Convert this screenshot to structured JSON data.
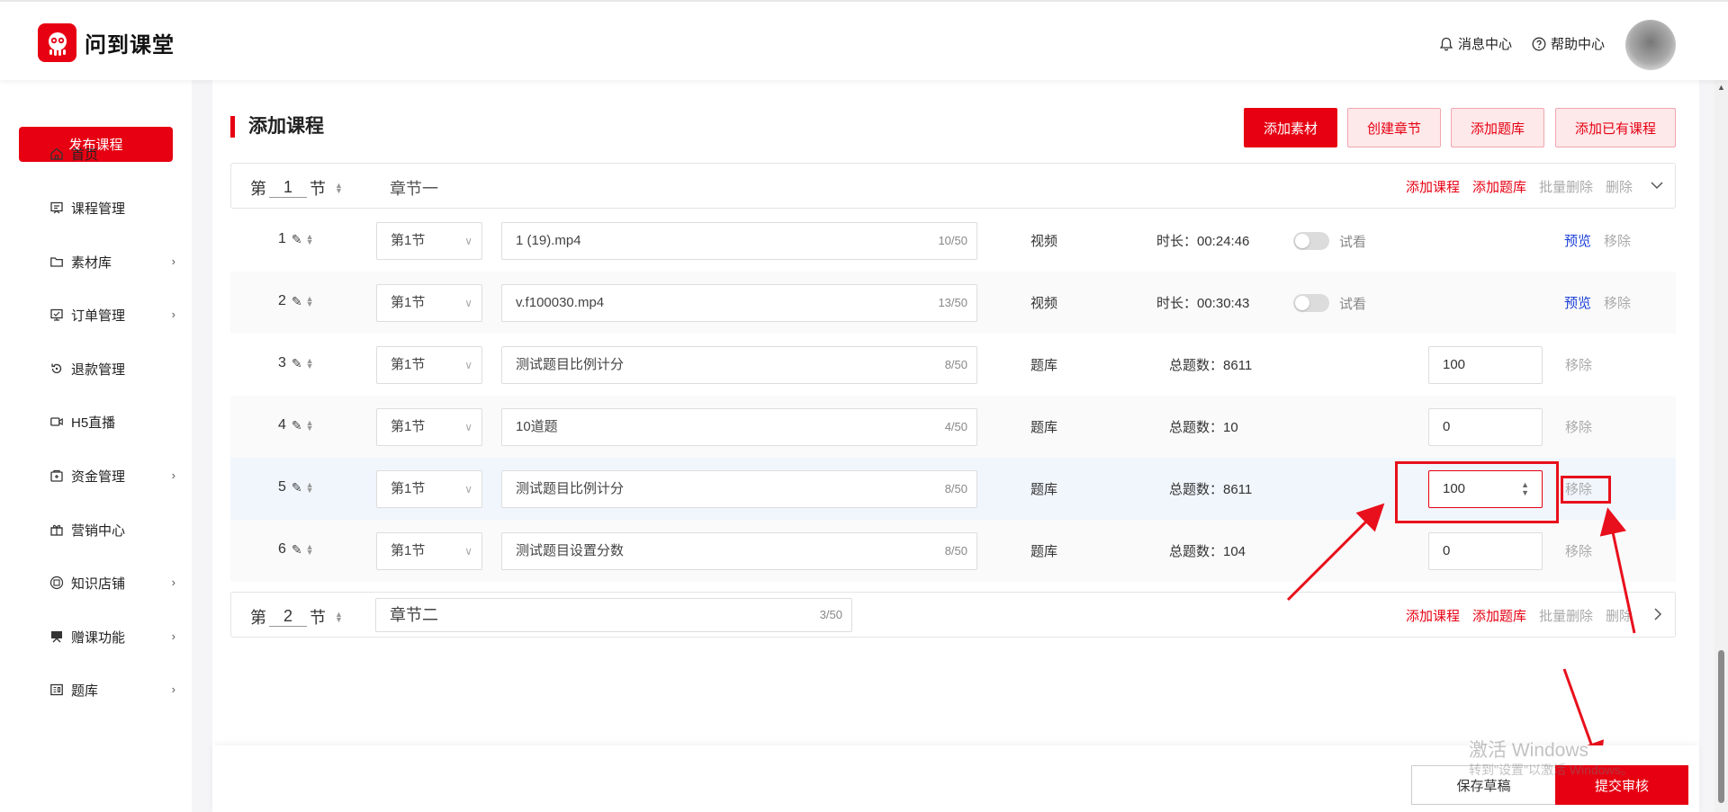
{
  "app": {
    "name": "问到课堂"
  },
  "header": {
    "messages": "消息中心",
    "help": "帮助中心"
  },
  "sidebar": {
    "publish": "发布课程",
    "items": [
      {
        "label": "首页",
        "icon": "home-icon",
        "chevron": false
      },
      {
        "label": "课程管理",
        "icon": "course-icon",
        "chevron": false
      },
      {
        "label": "素材库",
        "icon": "folder-icon",
        "chevron": true
      },
      {
        "label": "订单管理",
        "icon": "order-icon",
        "chevron": true
      },
      {
        "label": "退款管理",
        "icon": "refund-icon",
        "chevron": false
      },
      {
        "label": "H5直播",
        "icon": "live-icon",
        "chevron": false
      },
      {
        "label": "资金管理",
        "icon": "wallet-icon",
        "chevron": true
      },
      {
        "label": "营销中心",
        "icon": "gift-icon",
        "chevron": false
      },
      {
        "label": "知识店铺",
        "icon": "shop-icon",
        "chevron": true
      },
      {
        "label": "赠课功能",
        "icon": "gift-course-icon",
        "chevron": true
      },
      {
        "label": "题库",
        "icon": "question-bank-icon",
        "chevron": true
      }
    ]
  },
  "main": {
    "title": "添加课程",
    "buttons": {
      "add_material": "添加素材",
      "create_chapter": "创建章节",
      "add_bank": "添加题库",
      "add_existing": "添加已有课程"
    },
    "sections": [
      {
        "prefix": "第",
        "num": "1",
        "suffix": "节",
        "name": "章节一",
        "count": ""
      },
      {
        "prefix": "第",
        "num": "2",
        "suffix": "节",
        "name": "章节二",
        "count": "3/50"
      }
    ],
    "section_actions": {
      "add_course": "添加课程",
      "add_bank": "添加题库",
      "batch_delete": "批量删除",
      "delete": "删除"
    },
    "rows": [
      {
        "idx": "1",
        "section": "第1节",
        "name": "1 (19).mp4",
        "count": "10/50",
        "type": "视频",
        "meta": "时长：00:24:46",
        "trial": "试看",
        "preview": "预览",
        "remove": "移除"
      },
      {
        "idx": "2",
        "section": "第1节",
        "name": "v.f100030.mp4",
        "count": "13/50",
        "type": "视频",
        "meta": "时长：00:30:43",
        "trial": "试看",
        "preview": "预览",
        "remove": "移除"
      },
      {
        "idx": "3",
        "section": "第1节",
        "name": "测试题目比例计分",
        "count": "8/50",
        "type": "题库",
        "meta": "总题数：8611",
        "score": "100",
        "remove": "移除"
      },
      {
        "idx": "4",
        "section": "第1节",
        "name": "10道题",
        "count": "4/50",
        "type": "题库",
        "meta": "总题数：10",
        "score": "0",
        "remove": "移除"
      },
      {
        "idx": "5",
        "section": "第1节",
        "name": "测试题目比例计分",
        "count": "8/50",
        "type": "题库",
        "meta": "总题数：8611",
        "score": "100",
        "remove": "移除"
      },
      {
        "idx": "6",
        "section": "第1节",
        "name": "测试题目设置分数",
        "count": "8/50",
        "type": "题库",
        "meta": "总题数：104",
        "score": "0",
        "remove": "移除"
      }
    ]
  },
  "footer": {
    "draft": "保存草稿",
    "submit": "提交审核"
  },
  "watermark": {
    "line1": "激活 Windows",
    "line2": "转到\"设置\"以激活 Windows。"
  },
  "colors": {
    "brand": "#e60012",
    "link": "#1b3fd8",
    "annotation": "#e8101c"
  }
}
